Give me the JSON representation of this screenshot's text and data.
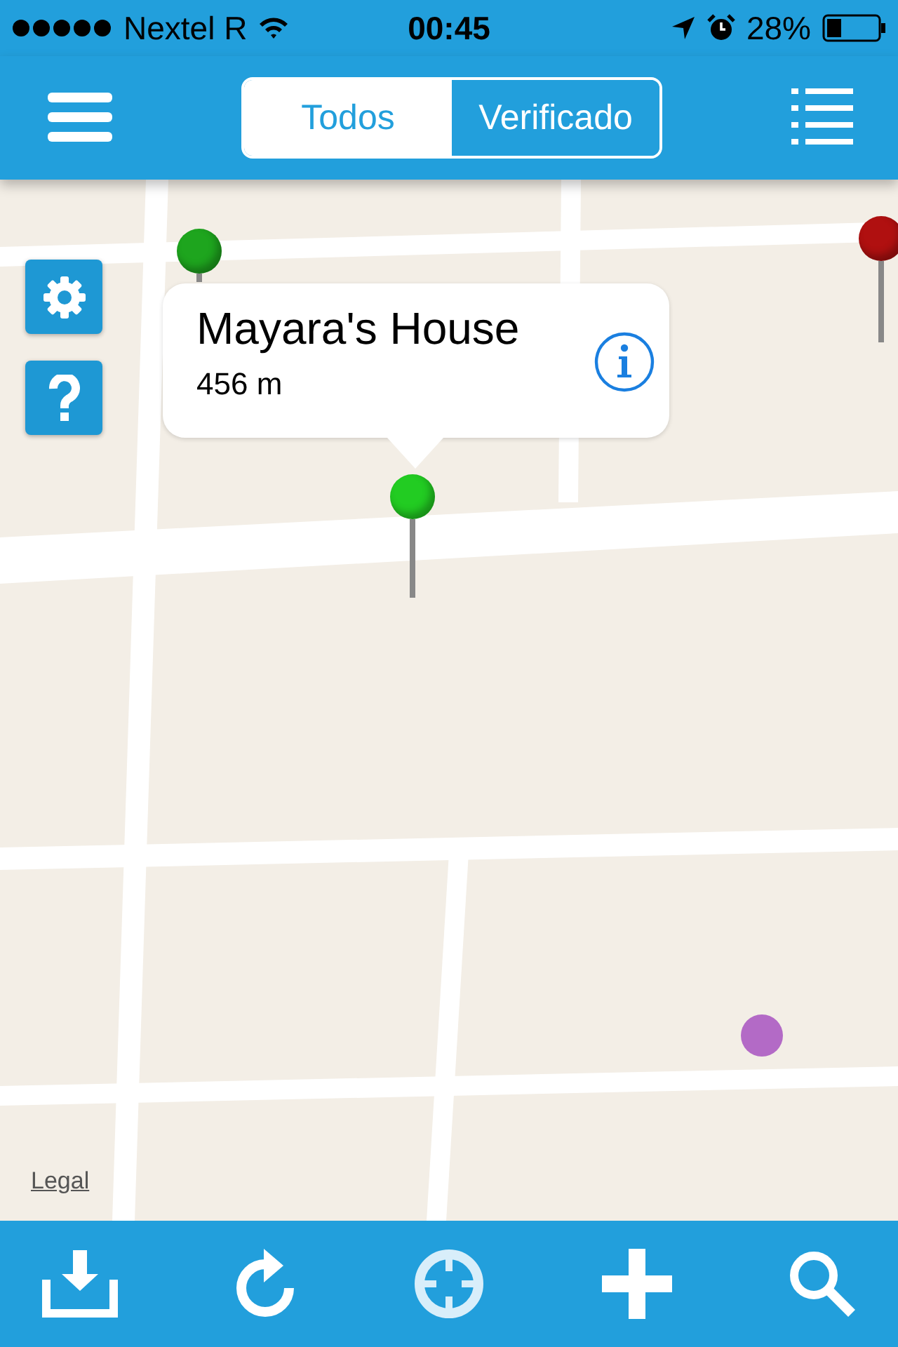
{
  "status_bar": {
    "carrier": "Nextel R",
    "time": "00:45",
    "battery": "28%"
  },
  "nav": {
    "segments": [
      {
        "label": "Todos",
        "selected": false
      },
      {
        "label": "Verificado",
        "selected": true
      }
    ]
  },
  "map": {
    "pins": [
      {
        "color": "#1ea51e"
      },
      {
        "color": "#22cc22"
      },
      {
        "color": "#b01010"
      }
    ],
    "callout": {
      "title": "Mayara's House",
      "distance": "456 m"
    },
    "legal": "Legal"
  }
}
